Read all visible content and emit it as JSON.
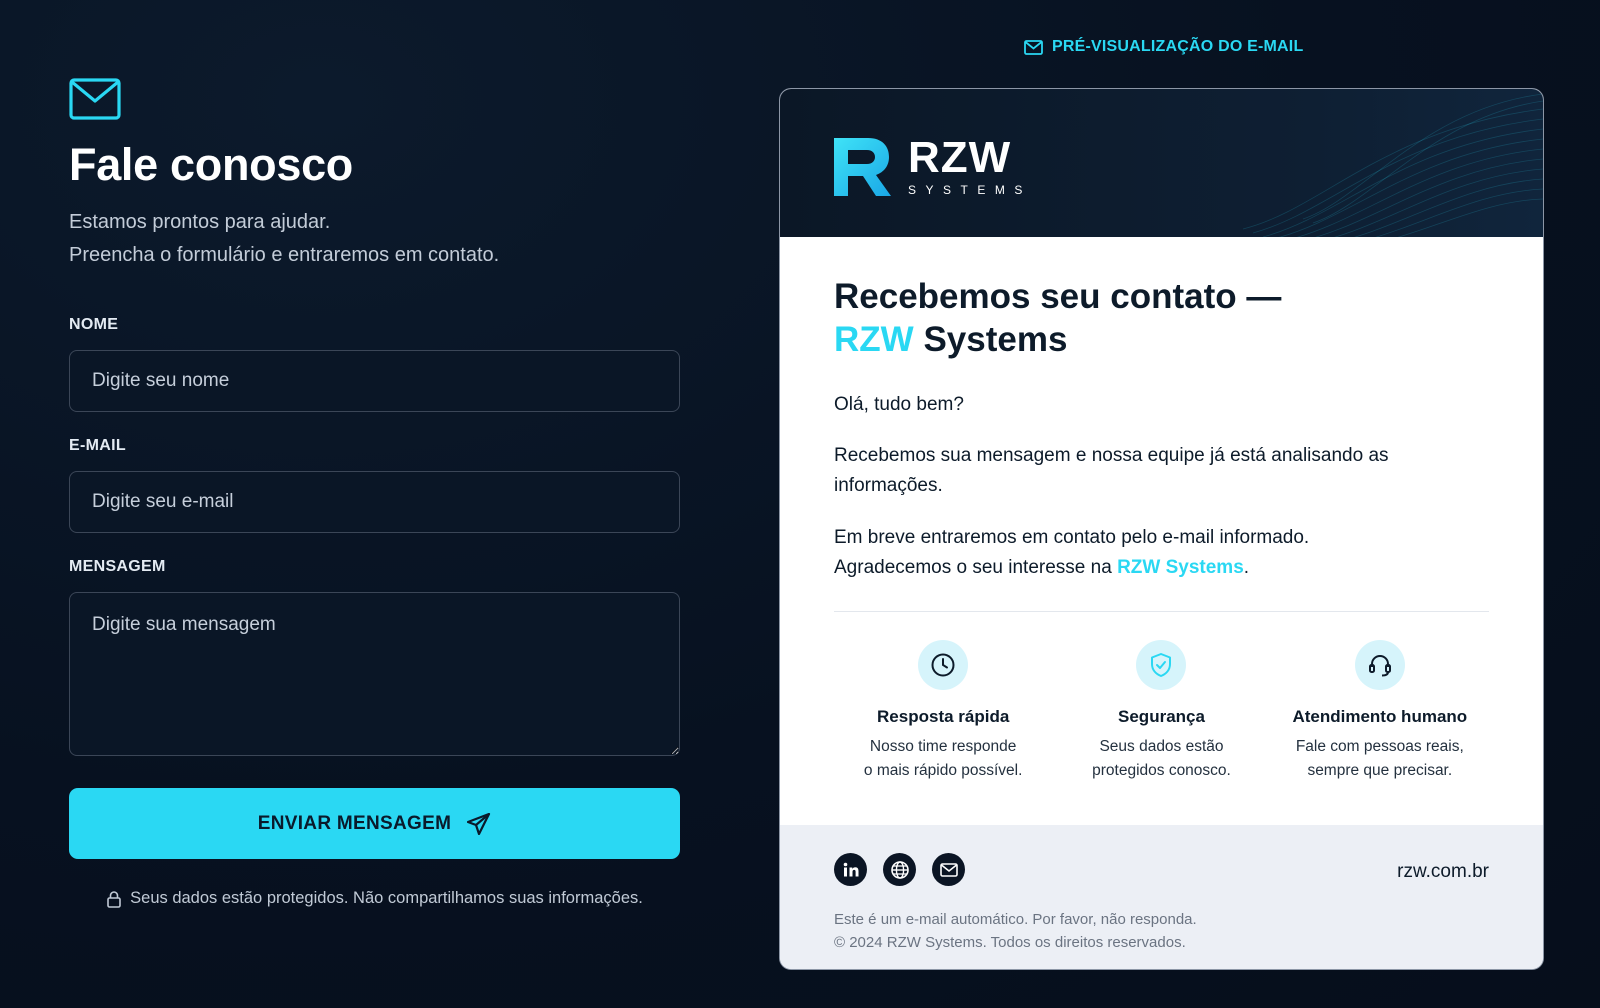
{
  "form": {
    "icon": "envelope-icon",
    "title": "Fale conosco",
    "subtitle_line1": "Estamos prontos para ajudar.",
    "subtitle_line2": "Preencha o formulário e entraremos em contato.",
    "name": {
      "label": "NOME",
      "placeholder": "Digite seu nome",
      "value": ""
    },
    "email": {
      "label": "E-MAIL",
      "placeholder": "Digite seu e-mail",
      "value": ""
    },
    "message": {
      "label": "MENSAGEM",
      "placeholder": "Digite sua mensagem",
      "value": ""
    },
    "submit_label": "ENVIAR MENSAGEM",
    "submit_icon": "paper-plane-icon",
    "privacy_icon": "lock-icon",
    "privacy_text": "Seus dados estão protegidos. Não compartilhamos suas informações."
  },
  "preview": {
    "label": "PRÉ-VISUALIZAÇÃO DO E-MAIL",
    "label_icon": "envelope-icon",
    "logo_name": "RZW",
    "logo_sub": "SYSTEMS",
    "title_line1": "Recebemos seu contato —",
    "title_brand": "RZW",
    "title_rest": "Systems",
    "greeting": "Olá, tudo bem?",
    "para1": "Recebemos sua mensagem e nossa equipe já está analisando as informações.",
    "para2_line1": "Em breve entraremos em contato pelo e-mail informado.",
    "para2_line2_prefix": "Agradecemos o seu interesse na ",
    "para2_brand": "RZW Systems",
    "para2_suffix": ".",
    "features": [
      {
        "icon": "clock-icon",
        "title": "Resposta rápida",
        "desc1": "Nosso time responde",
        "desc2": "o mais rápido possível."
      },
      {
        "icon": "shield-check-icon",
        "title": "Segurança",
        "desc1": "Seus dados estão",
        "desc2": "protegidos conosco."
      },
      {
        "icon": "headset-icon",
        "title": "Atendimento humano",
        "desc1": "Fale com pessoas reais,",
        "desc2": "sempre que precisar."
      }
    ],
    "social": [
      "linkedin-icon",
      "globe-icon",
      "mail-icon"
    ],
    "site": "rzw.com.br",
    "legal1": "Este é um e-mail automático. Por favor, não responda.",
    "legal2": "© 2024 RZW Systems. Todos os direitos reservados."
  },
  "colors": {
    "accent": "#2ad8f3",
    "background": "#071120",
    "card_header": "#0b1726",
    "footer": "#eceff5"
  }
}
